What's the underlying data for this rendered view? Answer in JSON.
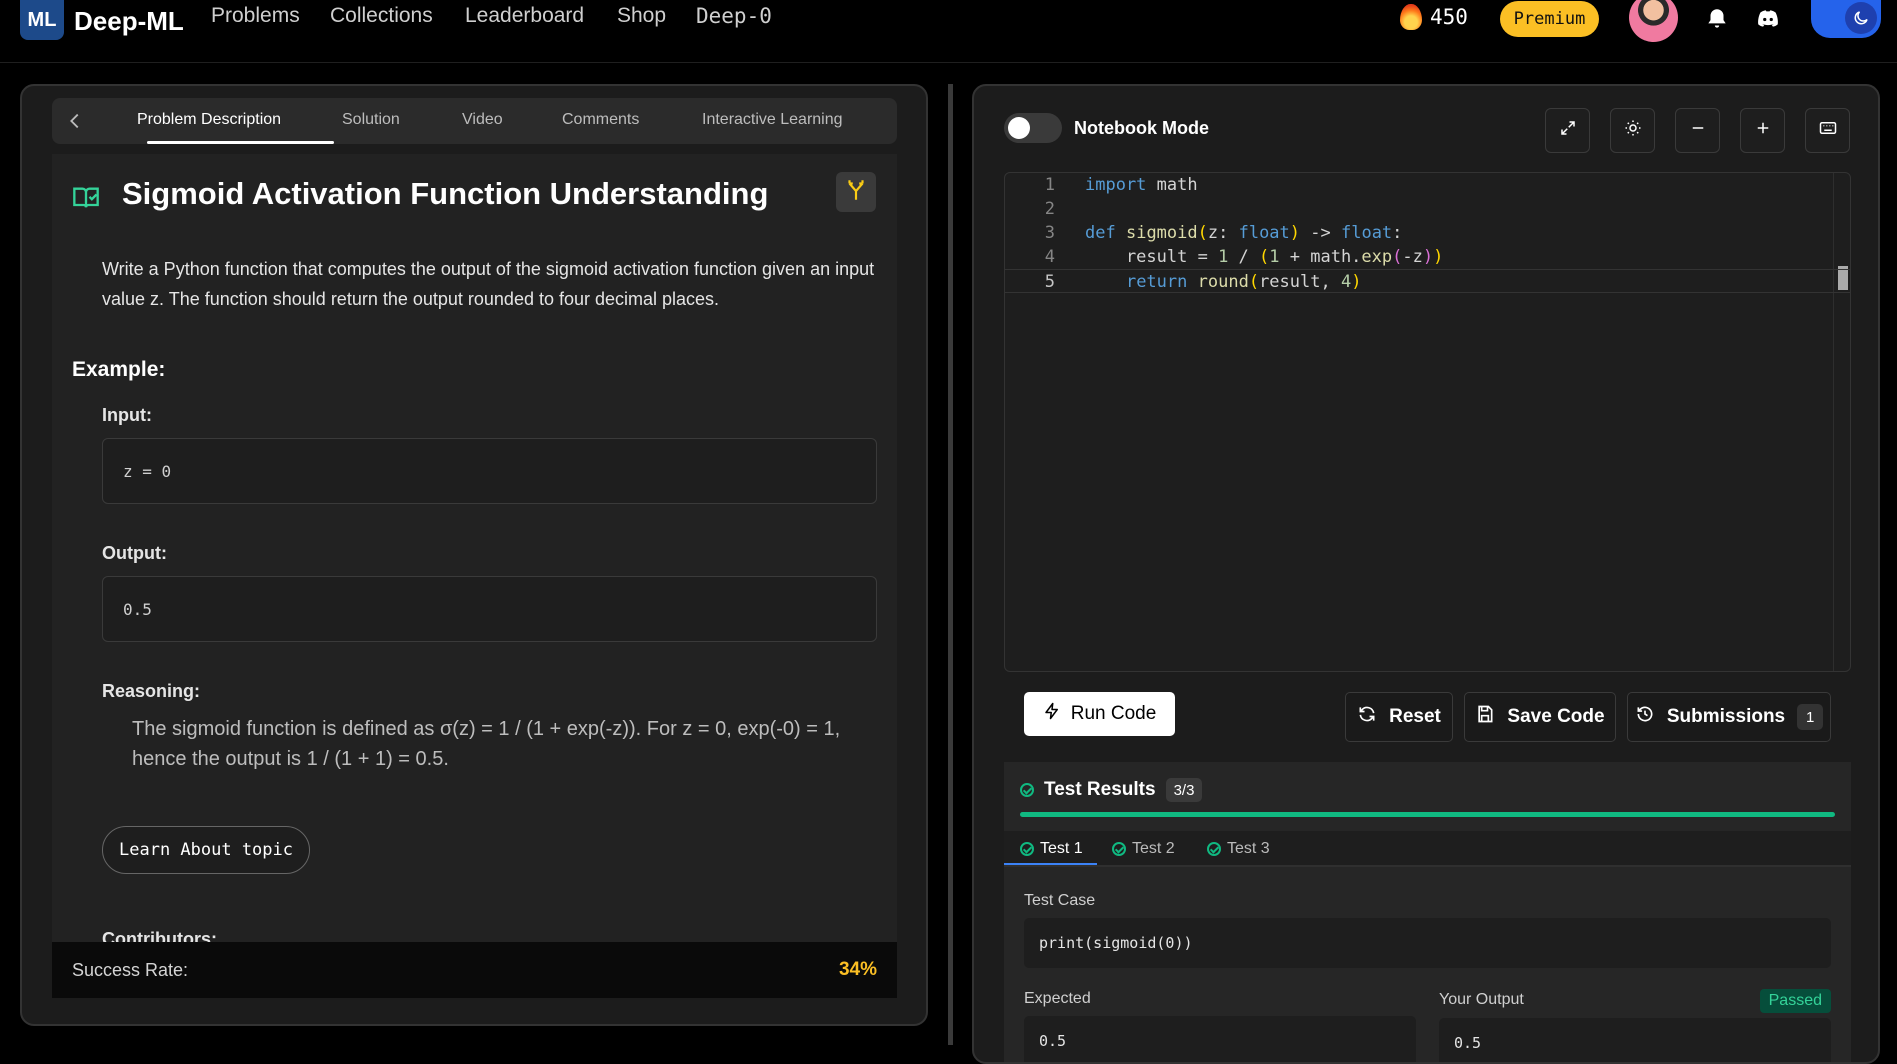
{
  "nav": {
    "brand": "Deep-ML",
    "links": [
      "Problems",
      "Collections",
      "Leaderboard",
      "Shop",
      "Deep-0"
    ],
    "streak": "450",
    "premium": "Premium"
  },
  "left": {
    "tabs": [
      "Problem Description",
      "Solution",
      "Video",
      "Comments",
      "Interactive Learning"
    ],
    "title": "Sigmoid Activation Function Understanding",
    "description": "Write a Python function that computes the output of the sigmoid activation function given an input value z. The function should return the output rounded to four decimal places.",
    "example_heading": "Example:",
    "input_label": "Input:",
    "input_value": "z = 0",
    "output_label": "Output:",
    "output_value": "0.5",
    "reasoning_label": "Reasoning:",
    "reasoning": "The sigmoid function is defined as σ(z) = 1 / (1 + exp(-z)). For z = 0, exp(-0) = 1, hence the output is 1 / (1 + 1) = 0.5.",
    "learn_button": "Learn About topic",
    "contributors_label": "Contributors:",
    "success_label": "Success Rate:",
    "success_value": "34%"
  },
  "right": {
    "notebook_label": "Notebook Mode",
    "line_numbers": [
      "1",
      "2",
      "3",
      "4",
      "5"
    ],
    "run_label": "Run Code",
    "reset_label": "Reset",
    "save_label": "Save Code",
    "submissions_label": "Submissions",
    "submissions_count": "1",
    "results_title": "Test Results",
    "results_count": "3/3",
    "results_fraction": 1.0,
    "test_tabs": [
      "Test 1",
      "Test 2",
      "Test 3"
    ],
    "test_case_label": "Test Case",
    "test_case": "print(sigmoid(0))",
    "expected_label": "Expected",
    "expected_value": "0.5",
    "your_output_label": "Your Output",
    "your_output_value": "0.5",
    "status": "Passed"
  },
  "colors": {
    "accent_green": "#10b981",
    "premium": "#fbbf24",
    "toggle_blue": "#2563eb"
  }
}
